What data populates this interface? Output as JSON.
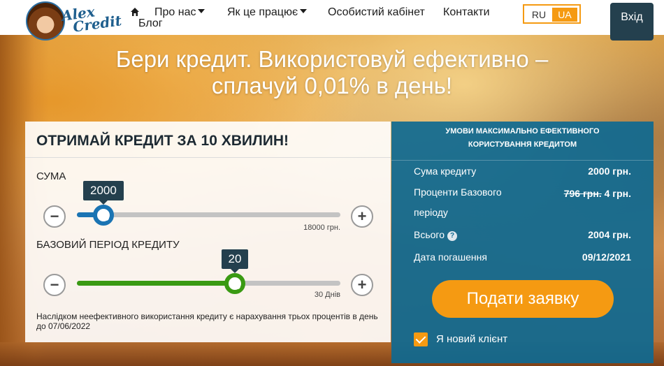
{
  "header": {
    "logo_text_line1": "Alex",
    "logo_text_line2": "Credit",
    "nav": {
      "about": "Про нас",
      "how": "Як це працює",
      "cabinet": "Особистий кабінет",
      "contacts": "Контакти",
      "blog": "Блог"
    },
    "lang": {
      "ru": "RU",
      "ua": "UA",
      "active": "UA"
    },
    "login": "Вхід"
  },
  "hero": {
    "line1": "Бери кредит. Використовуй ефективно –",
    "line2": "сплачуй 0,01% в день!"
  },
  "calculator": {
    "title": "ОТРИМАЙ КРЕДИТ ЗА 10 ХВИЛИН!",
    "amount": {
      "label": "СУМА",
      "value": "2000",
      "max_label": "18000 грн.",
      "level": 0.1
    },
    "period": {
      "label": "БАЗОВИЙ ПЕРІОД КРЕДИТУ",
      "value": "20",
      "max_label": "30 Днів",
      "level": 0.6
    },
    "minus": "−",
    "plus": "+",
    "note": "Наслідком неефективного використання кредиту є нарахування трьох процентів в день до 07/06/2022"
  },
  "info": {
    "title_line1": "УМОВИ МАКСИМАЛЬНО ЕФЕКТИВНОГО",
    "title_line2": "КОРИСТУВАННЯ КРЕДИТОМ",
    "rows": [
      {
        "label": "Сума кредиту",
        "value": "2000 грн."
      },
      {
        "label_line1": "Проценти Базового",
        "label_line2": "періоду",
        "old_value": "796 грн.",
        "value": "4 грн."
      },
      {
        "label": "Всього",
        "value": "2004 грн."
      },
      {
        "label": "Дата погашення",
        "value": "09/12/2021"
      }
    ],
    "apply_button": "Подати заявку",
    "new_client": {
      "label": "Я новий клієнт",
      "checked": true
    }
  },
  "colors": {
    "accent": "#f59a12",
    "dark": "#24404e",
    "slider_blue": "#1a74b3",
    "slider_green": "#3a9a13",
    "panel_blue": "#0e6991"
  }
}
